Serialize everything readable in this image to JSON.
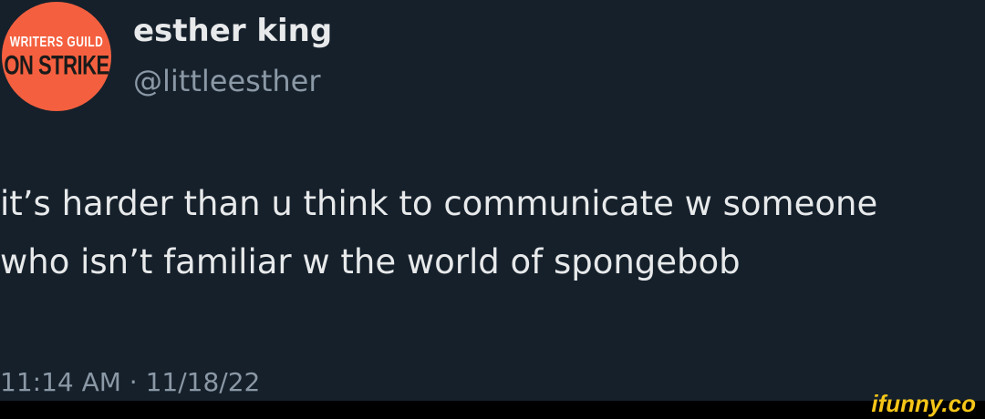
{
  "avatar": {
    "line1": "WRITERS GUILD",
    "line2": "ON STRIKE",
    "background": "#f4603f"
  },
  "author": {
    "display_name": "esther king",
    "handle": "@littleesther"
  },
  "tweet": {
    "lines": [
      "it’s harder than u think to communicate w someone",
      "who isn’t familiar w the world of spongebob"
    ],
    "timestamp": "11:14 AM · 11/18/22"
  },
  "watermark": {
    "text": "ifunny.co",
    "color": "#f5c518"
  }
}
